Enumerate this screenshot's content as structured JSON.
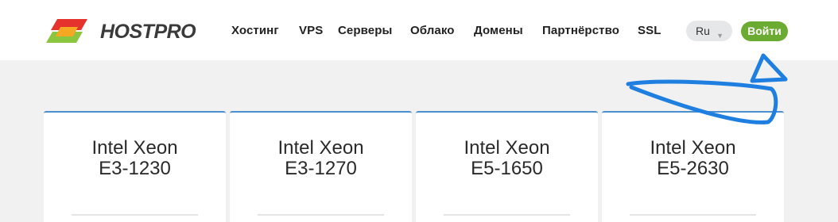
{
  "brand": {
    "part1": "HOST",
    "part2": "PRO"
  },
  "nav": [
    {
      "label": "Хостинг"
    },
    {
      "label": "VPS"
    },
    {
      "label": "Серверы"
    },
    {
      "label": "Облако"
    },
    {
      "label": "Домены"
    },
    {
      "label": "Партнёрство"
    },
    {
      "label": "SSL"
    }
  ],
  "language": {
    "selected": "Ru"
  },
  "login": {
    "label": "Войти"
  },
  "cards": [
    {
      "name": "Intel Xeon",
      "model": "E3-1230"
    },
    {
      "name": "Intel Xeon",
      "model": "E3-1270"
    },
    {
      "name": "Intel Xeon",
      "model": "E5-1650"
    },
    {
      "name": "Intel Xeon",
      "model": "E5-2630"
    }
  ],
  "colors": {
    "accent_green": "#6bab31",
    "card_border": "#4c8fcf",
    "annotation_blue": "#1e7fe0"
  },
  "icons": {
    "logo_mark": "hostpro-logo-icon",
    "language_chevron": "chevron-down-icon",
    "annotation": "hand-drawn-arrow-icon"
  }
}
